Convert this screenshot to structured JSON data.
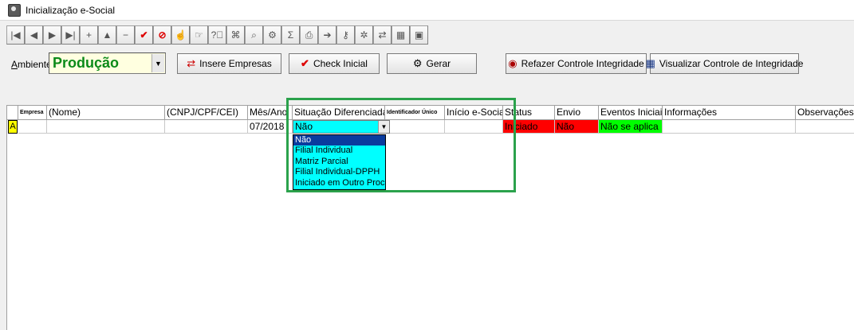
{
  "window": {
    "title": "Inicialização e-Social"
  },
  "toolbar": {
    "buttons": [
      {
        "icon": "first-record-icon",
        "glyph": "|◀"
      },
      {
        "icon": "prev-record-icon",
        "glyph": "◀"
      },
      {
        "icon": "next-record-icon",
        "glyph": "▶"
      },
      {
        "icon": "last-record-icon",
        "glyph": "▶|"
      },
      {
        "icon": "insert-icon",
        "glyph": "+"
      },
      {
        "icon": "up-icon",
        "glyph": "▲"
      },
      {
        "icon": "delete-icon",
        "glyph": "−"
      },
      {
        "icon": "post-check-icon",
        "glyph": "✔"
      },
      {
        "icon": "cancel-icon",
        "glyph": "⊘"
      },
      {
        "icon": "hand-icon",
        "glyph": "☝"
      },
      {
        "icon": "pointer-icon",
        "glyph": "☞"
      },
      {
        "icon": "help-icon",
        "glyph": "?⃝"
      },
      {
        "icon": "filter-icon",
        "glyph": "⌘"
      },
      {
        "icon": "find-icon",
        "glyph": "⌕"
      },
      {
        "icon": "tools-icon",
        "glyph": "⚙"
      },
      {
        "icon": "sum-icon",
        "glyph": "Σ"
      },
      {
        "icon": "print-icon",
        "glyph": "⎙"
      },
      {
        "icon": "export-icon",
        "glyph": "➔"
      },
      {
        "icon": "key-icon",
        "glyph": "⚷"
      },
      {
        "icon": "config-icon",
        "glyph": "✲"
      },
      {
        "icon": "arrows-icon",
        "glyph": "⇄"
      },
      {
        "icon": "calculator-icon",
        "glyph": "▦"
      },
      {
        "icon": "stop-icon",
        "glyph": "▣"
      }
    ]
  },
  "ambiente": {
    "label_prefix": "A",
    "label_rest": "mbiente",
    "value": "Produção"
  },
  "buttons": {
    "insere_empresas": "Insere Empresas",
    "check_inicial": "Check Inicial",
    "gerar": "Gerar",
    "refazer": "Refazer Controle Integridade",
    "visualizar": "Visualizar Controle de Integridade"
  },
  "grid": {
    "headers": {
      "empresa": "Empresa",
      "nome": "(Nome)",
      "cnpj": "(CNPJ/CPF/CEI)",
      "mes_ano": "Mês/Ano",
      "situacao": "Situação Diferenciada",
      "identificador": "Identificador Único",
      "inicio": "Início e-Social",
      "status": "Status",
      "envio": "Envio",
      "eventos": "Eventos Iniciais",
      "informacoes": "Informações",
      "observacoes": "Observações"
    },
    "row": {
      "indicator": "A",
      "mes_ano": "07/2018",
      "situacao": "Não",
      "status": "Iniciado",
      "envio": "Não",
      "eventos": "Não se aplica"
    },
    "dropdown_options": [
      "Não",
      "Filial Individual",
      "Matriz Parcial",
      "Filial Individual-DPPH",
      "Iniciado em Outro Proce"
    ],
    "colors": {
      "status_bg": "#ff0000",
      "envio_bg": "#ff0000",
      "eventos_bg": "#00ff00",
      "combo_bg": "#00ffff",
      "highlight": "#2ba24c"
    }
  }
}
